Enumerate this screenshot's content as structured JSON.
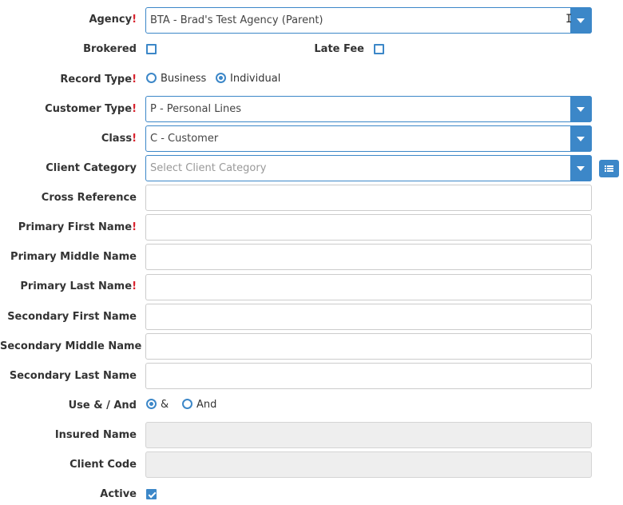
{
  "required_mark": "!",
  "agency": {
    "label": "Agency",
    "value": "BTA - Brad's Test Agency (Parent)"
  },
  "brokered": {
    "label": "Brokered",
    "checked": false
  },
  "late_fee": {
    "label": "Late Fee",
    "checked": false
  },
  "record_type": {
    "label": "Record Type",
    "options": [
      "Business",
      "Individual"
    ],
    "selected": "Individual"
  },
  "customer_type": {
    "label": "Customer Type",
    "value": "P - Personal Lines"
  },
  "class": {
    "label": "Class",
    "value": "C - Customer"
  },
  "client_category": {
    "label": "Client Category",
    "placeholder": "Select Client Category"
  },
  "cross_reference": {
    "label": "Cross Reference",
    "value": ""
  },
  "primary_first_name": {
    "label": "Primary First Name",
    "value": ""
  },
  "primary_middle_name": {
    "label": "Primary Middle Name",
    "value": ""
  },
  "primary_last_name": {
    "label": "Primary Last Name",
    "value": ""
  },
  "secondary_first_name": {
    "label": "Secondary First Name",
    "value": ""
  },
  "secondary_middle_name": {
    "label": "Secondary Middle Name",
    "value": ""
  },
  "secondary_last_name": {
    "label": "Secondary Last Name",
    "value": ""
  },
  "use_and": {
    "label": "Use & / And",
    "options": [
      "&",
      "And"
    ],
    "selected": "&"
  },
  "insured_name": {
    "label": "Insured Name",
    "value": ""
  },
  "client_code": {
    "label": "Client Code",
    "value": ""
  },
  "active": {
    "label": "Active",
    "checked": true
  },
  "colors": {
    "accent": "#3c87c8",
    "required": "#d9232e",
    "readonly_bg": "#eeeeee"
  }
}
